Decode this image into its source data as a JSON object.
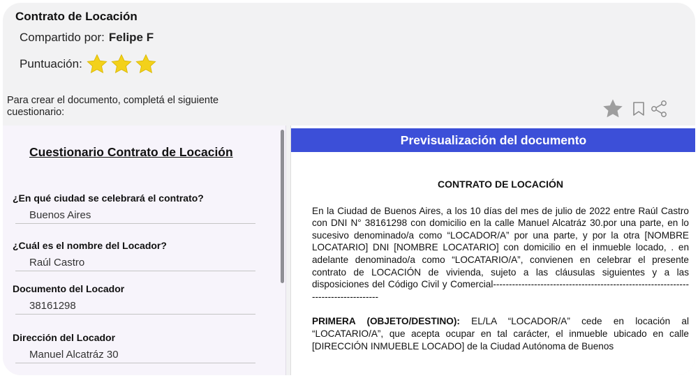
{
  "header": {
    "title": "Contrato de Locación",
    "shared_label": "Compartido por:",
    "shared_name": "Felipe F",
    "rating_label": "Puntuación:",
    "rating_stars": 3,
    "star_color": "#f3d11a"
  },
  "instruction": "Para crear el documento, completá el siguiente cuestionario:",
  "actions": {
    "icons": [
      "star-icon",
      "bookmark-icon",
      "share-icon"
    ],
    "icon_color": "#9e9e9e"
  },
  "questionnaire": {
    "title": "Cuestionario Contrato de Locación",
    "fields": [
      {
        "label": "¿En qué ciudad se celebrará el contrato?",
        "value": "Buenos Aires"
      },
      {
        "label": "¿Cuál es el nombre del Locador?",
        "value": "Raúl Castro"
      },
      {
        "label": "Documento del Locador",
        "value": "38161298"
      },
      {
        "label": "Dirección del Locador",
        "value": "Manuel Alcatráz 30"
      }
    ]
  },
  "preview": {
    "header": "Previsualización del documento",
    "header_color": "#3c4fd8",
    "doc_title": "CONTRATO DE LOCACIÓN",
    "paragraph1": "En la Ciudad de Buenos Aires, a los 10 días del mes de julio de 2022 entre Raúl Castro con DNI N° 38161298 con domicilio en la calle Manuel Alcatráz 30.por una parte, en lo sucesivo denominado/a como “LOCADOR/A” por una parte, y por la otra [NOMBRE LOCATARIO] DNI [NOMBRE LOCATARIO] con domicilio en el inmueble locado, . en adelante denominado/a como “LOCATARIO/A”, convienen en celebrar el presente contrato de LOCACIÓN de vivienda, sujeto a las cláusulas siguientes y a las disposiciones del Código Civil y Comercial-----------------------------------------------------------------------------------",
    "clause1_heading": "PRIMERA (OBJETO/DESTINO):",
    "clause1_text": " EL/LA “LOCADOR/A” cede en locación al “LOCATARIO/A”, que acepta ocupar en tal carácter, el inmueble ubicado en calle [DIRECCIÓN INMUEBLE LOCADO] de la Ciudad Autónoma de Buenos"
  }
}
